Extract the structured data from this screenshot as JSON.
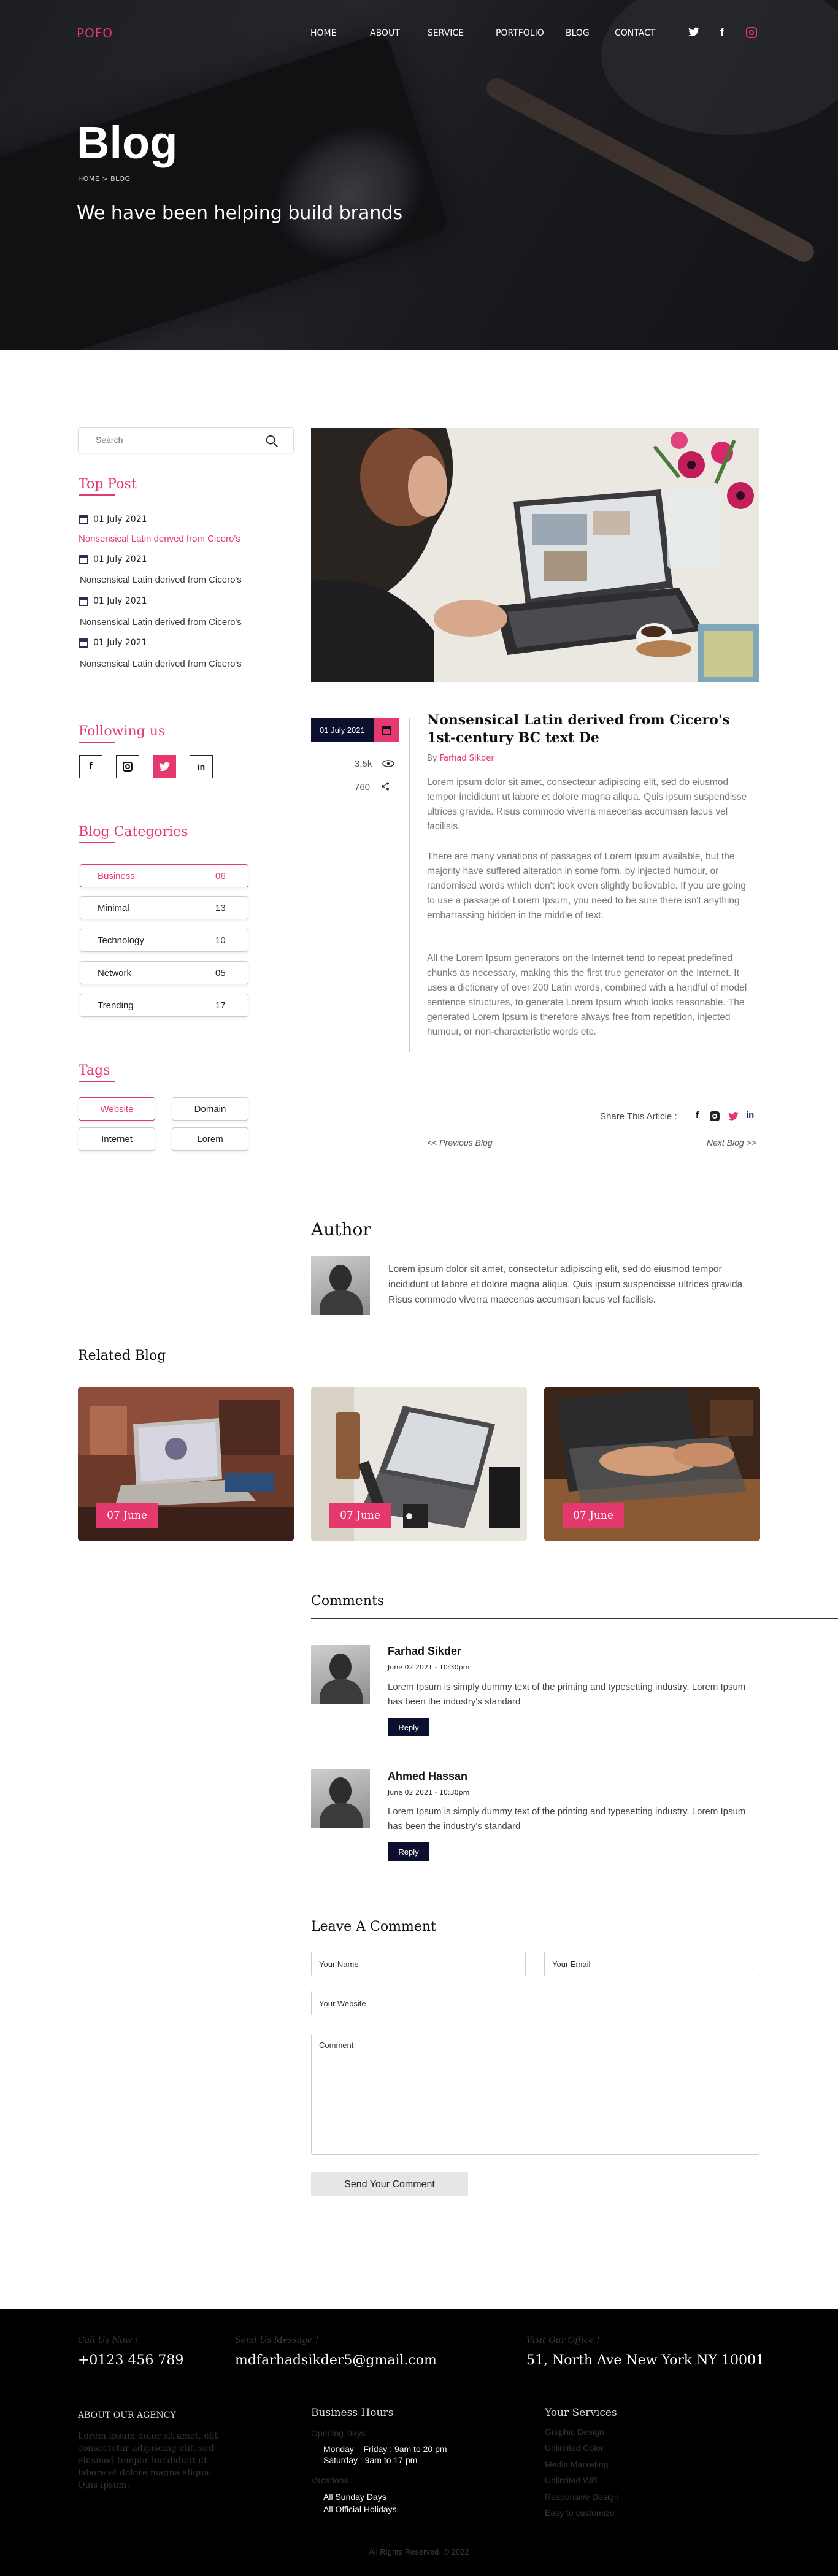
{
  "header": {
    "logo": "POFO",
    "nav": [
      "HOME",
      "ABOUT",
      "SERVICE",
      "PORTFOLIO",
      "BLOG",
      "CONTACT"
    ],
    "social": [
      "twitter-icon",
      "facebook-icon",
      "instagram-icon"
    ],
    "title": "Blog",
    "breadcrumb": "HOME > BLOG",
    "subtitle": "We have been helping build brands"
  },
  "sidebar": {
    "search_placeholder": "Search",
    "top_post_title": "Top Post",
    "top_posts": [
      {
        "date": "01 July 2021",
        "title": "Nonsensical Latin derived  from Cicero's"
      },
      {
        "date": "01 July 2021",
        "title": "Nonsensical Latin derived  from Cicero's"
      },
      {
        "date": "01 July 2021",
        "title": "Nonsensical Latin derived  from Cicero's"
      },
      {
        "date": "01 July 2021",
        "title": "Nonsensical Latin derived  from Cicero's"
      }
    ],
    "following_title": "Following us",
    "following": [
      "f",
      "◎",
      "t",
      "in"
    ],
    "categories_title": "Blog Categories",
    "categories": [
      {
        "name": "Business",
        "count": "06"
      },
      {
        "name": "Minimal",
        "count": "13"
      },
      {
        "name": "Technology",
        "count": "10"
      },
      {
        "name": "Network",
        "count": "05"
      },
      {
        "name": "Trending",
        "count": "17"
      }
    ],
    "tags_title": "Tags",
    "tags": [
      "Website",
      "Domain",
      "Internet",
      "Lorem"
    ]
  },
  "post": {
    "date": "01 July 2021",
    "views": "3.5k",
    "shares": "760",
    "title": "Nonsensical Latin derived from Cicero's 1st-century BC text De",
    "by_label": "By",
    "author": "Farhad Sikder",
    "paragraphs": [
      "Lorem ipsum dolor sit amet, consectetur adipiscing elit, sed do eiusmod tempor incididunt ut labore et dolore magna aliqua. Quis ipsum suspendisse ultrices gravida. Risus commodo viverra maecenas accumsan lacus vel facilisis.",
      "There are many variations of passages of Lorem Ipsum available, but the majority have suffered alteration in some form, by injected humour, or randomised words which don't look even slightly believable. If you are going to use a passage of Lorem Ipsum, you need to be sure there isn't anything embarrassing hidden in the middle of text.",
      "All the Lorem Ipsum generators on the Internet tend to repeat predefined chunks as necessary, making this the first true generator on the Internet. It uses a dictionary of over 200 Latin words, combined with a handful of model sentence structures, to generate Lorem Ipsum which looks reasonable. The generated Lorem Ipsum is therefore always free from repetition, injected humour, or non-characteristic words etc."
    ],
    "share_label": "Share This Article :",
    "prev": "<< Previous Blog",
    "next": "Next Blog >>"
  },
  "author_section": {
    "title": "Author",
    "text": "Lorem ipsum dolor sit amet, consectetur adipiscing elit, sed do eiusmod tempor incididunt ut labore et dolore magna aliqua. Quis ipsum suspendisse ultrices gravida. Risus commodo viverra maecenas accumsan lacus vel facilisis."
  },
  "related": {
    "title": "Related Blog",
    "items": [
      {
        "date": "07 June"
      },
      {
        "date": "07 June"
      },
      {
        "date": "07 June"
      }
    ]
  },
  "comments": {
    "title": "Comments",
    "items": [
      {
        "name": "Farhad Sikder",
        "date": "June 02 2021  -  10:30pm",
        "text": "Lorem Ipsum is simply dummy text of the printing and typesetting industry. Lorem Ipsum has been the industry's standard",
        "reply": "Reply"
      },
      {
        "name": "Ahmed Hassan",
        "date": "June 02 2021  -  10:30pm",
        "text": "Lorem Ipsum is simply dummy text of the printing and typesetting industry. Lorem Ipsum has been the industry's standard",
        "reply": "Reply"
      }
    ]
  },
  "leave": {
    "title": "Leave A Comment",
    "name_ph": "Your Name",
    "email_ph": "Your Email",
    "website_ph": "Your Website",
    "comment_ph": "Comment",
    "send": "Send Your Comment"
  },
  "footer": {
    "call_label": "Call Us Now !",
    "phone": "+0123 456 789",
    "msg_label": "Send Us Message !",
    "email": "mdfarhadsikder5@gmail.com",
    "office_label": "Visit Our Office !",
    "address": "51, North Ave New York NY 10001",
    "about_title": "ABOUT OUR AGENCY",
    "about_text": "Lorem ipsum dolor sit amet, elit consectetur adipiscing elit, sed eiusmod tempor incididunt ut labore et dolore magna aliqua. Quis ipsum.",
    "hours_title": "Business Hours",
    "opening_label": "Opening Days :",
    "opening_lines": [
      "Monday – Friday : 9am to 20 pm",
      "Saturday : 9am to 17 pm"
    ],
    "vacations_label": "Vacations :",
    "vacation_lines": [
      "All Sunday Days",
      "All Official Holidays"
    ],
    "services_title": "Your  Services",
    "services": [
      "Graphic Design",
      "Unlimited Color",
      "Media Marketing",
      "Unlimited Wifi",
      "Responsive Design",
      "Easy to customize"
    ],
    "copyright": "All Rights Reserved. © 2022"
  },
  "colors": {
    "accent": "#e5386d",
    "navy": "#0d0f2e"
  }
}
